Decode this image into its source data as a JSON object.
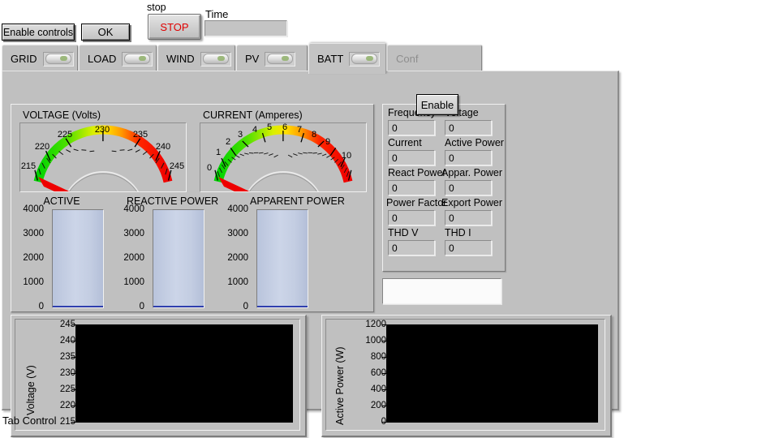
{
  "toolbar": {
    "enable_controls_label": "Enable controls",
    "ok_label": "OK",
    "stop_caption": "stop",
    "stop_label": "STOP",
    "time_caption": "Time",
    "time_value": ""
  },
  "tabs": [
    {
      "label": "GRID",
      "led": "boolean-led",
      "selected": false,
      "disabled": false
    },
    {
      "label": "LOAD",
      "led": "boolean-led",
      "selected": false,
      "disabled": false
    },
    {
      "label": "WIND",
      "led": "boolean-led",
      "selected": false,
      "disabled": false
    },
    {
      "label": "PV",
      "led": "boolean-led",
      "selected": false,
      "disabled": false
    },
    {
      "label": "BATT",
      "led": "boolean-led",
      "selected": true,
      "disabled": false
    },
    {
      "label": "Conf",
      "led": null,
      "selected": false,
      "disabled": true
    }
  ],
  "enable_overlay_label": "Enable",
  "gauges": [
    {
      "title": "VOLTAGE (Volts)",
      "unit": "Volts",
      "min": 215,
      "max": 245,
      "step": 5,
      "ticks": [
        215,
        220,
        225,
        230,
        235,
        240,
        245
      ],
      "value": 215,
      "needle_color": "#ee0000"
    },
    {
      "title": "CURRENT (Amperes)",
      "unit": "Amperes",
      "min": 0,
      "max": 10,
      "step": 1,
      "ticks": [
        0,
        1,
        2,
        3,
        4,
        5,
        6,
        7,
        8,
        9,
        10
      ],
      "value": 0,
      "needle_color": "#ee0000"
    }
  ],
  "bars": [
    {
      "title": "ACTIVE",
      "min": 0,
      "max": 4000,
      "ticks": [
        4000,
        3000,
        2000,
        1000,
        0
      ],
      "value": 0
    },
    {
      "title": "REACTIVE POWER",
      "min": 0,
      "max": 4000,
      "ticks": [
        4000,
        3000,
        2000,
        1000,
        0
      ],
      "value": 0
    },
    {
      "title": "APPARENT POWER",
      "min": 0,
      "max": 4000,
      "ticks": [
        4000,
        3000,
        2000,
        1000,
        0
      ],
      "value": 0
    }
  ],
  "numerics": [
    {
      "label": "Frequency",
      "value": "0"
    },
    {
      "label": "Voltage",
      "value": "0"
    },
    {
      "label": "Current",
      "value": "0"
    },
    {
      "label": "Active Power",
      "value": "0"
    },
    {
      "label": "React Power",
      "value": "0"
    },
    {
      "label": "Appar. Power",
      "value": "0"
    },
    {
      "label": "Power Factor",
      "value": "0"
    },
    {
      "label": "Export Power",
      "value": "0"
    },
    {
      "label": "THD V",
      "value": "0"
    },
    {
      "label": "THD I",
      "value": "0"
    }
  ],
  "string_indicator": {
    "value": ""
  },
  "charts": [
    {
      "ylabel": "Voltage (V)",
      "yticks": [
        245,
        240,
        235,
        230,
        225,
        220,
        215
      ],
      "ylim": [
        215,
        245
      ],
      "background": "#000000",
      "series": []
    },
    {
      "ylabel": "Active Power (W)",
      "yticks": [
        1200,
        1000,
        800,
        600,
        400,
        200,
        0
      ],
      "ylim": [
        0,
        1200
      ],
      "background": "#000000",
      "series": []
    }
  ],
  "status": {
    "tab_control_label": "Tab Control"
  },
  "colors": {
    "panel": "#c0c0c0",
    "stop_text": "#e00000",
    "gauge_low": "#00d000",
    "gauge_mid": "#ffe000",
    "gauge_high": "#ff0000",
    "bar_fill": "#c3cde2",
    "plot_bg": "#000000"
  }
}
